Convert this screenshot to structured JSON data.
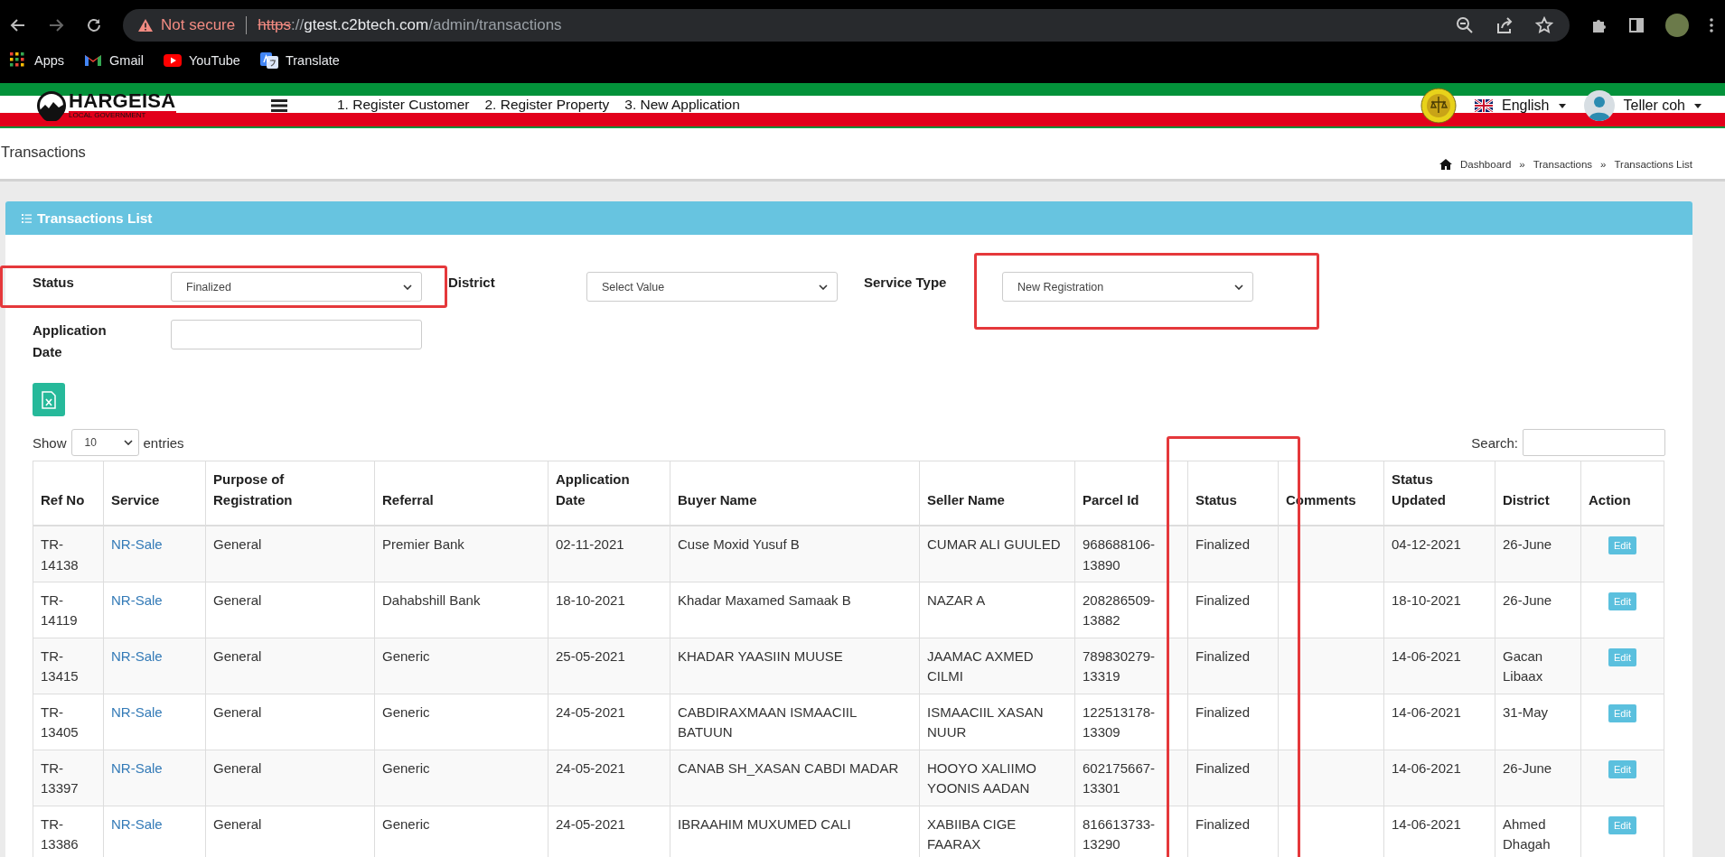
{
  "browser": {
    "warning": "Not secure",
    "url_scheme": "https",
    "url_separator": "://",
    "url_host": "gtest.c2btech.com",
    "url_path": "/admin/transactions",
    "bookmarks": [
      {
        "label": "Apps",
        "kind": "apps"
      },
      {
        "label": "Gmail",
        "kind": "mail"
      },
      {
        "label": "YouTube",
        "kind": "video"
      },
      {
        "label": "Translate",
        "kind": "translate"
      }
    ]
  },
  "header": {
    "logo_title": "HARGEISA",
    "logo_subtitle": "LOCAL GOVERNMENT",
    "nav": [
      "1. Register Customer",
      "2. Register Property",
      "3. New Application"
    ],
    "language": "English",
    "user": "Teller coh"
  },
  "page": {
    "title": "Transactions",
    "breadcrumb": [
      "Dashboard",
      "Transactions",
      "Transactions List"
    ],
    "separator": "»"
  },
  "panel": {
    "title": "Transactions List",
    "filters": [
      {
        "label": "Status",
        "kind": "select",
        "value": "Finalized",
        "highlighted": true
      },
      {
        "label": "District",
        "kind": "select",
        "value": "Select Value",
        "highlighted": false
      },
      {
        "label": "Service Type",
        "kind": "select",
        "value": "New Registration",
        "highlighted": true
      },
      {
        "label": "Application Date",
        "kind": "date",
        "highlighted": false
      }
    ],
    "show_label": "Show",
    "page_size": "10",
    "entries_label": "entries",
    "search_label": "Search:"
  },
  "table": {
    "columns": [
      {
        "label": "Ref No",
        "highlighted": false
      },
      {
        "label": "Service",
        "highlighted": false
      },
      {
        "label": "Purpose of Registration",
        "highlighted": false
      },
      {
        "label": "Referral",
        "highlighted": false
      },
      {
        "label": "Application Date",
        "highlighted": false
      },
      {
        "label": "Buyer Name",
        "highlighted": false
      },
      {
        "label": "Seller Name",
        "highlighted": false
      },
      {
        "label": "Parcel Id",
        "highlighted": false
      },
      {
        "label": "Status",
        "highlighted": true
      },
      {
        "label": "Comments",
        "highlighted": false
      },
      {
        "label": "Status Updated",
        "highlighted": false
      },
      {
        "label": "District",
        "highlighted": false
      },
      {
        "label": "Action",
        "highlighted": false
      }
    ],
    "rows": [
      {
        "ref": "TR-14138",
        "service": "NR-Sale",
        "purpose": "General",
        "referral": "Premier Bank",
        "date": "02-11-2021",
        "buyer": "Cuse Moxid Yusuf B",
        "seller": "CUMAR ALI GUULED",
        "parcel": "968688106-13890",
        "status": "Finalized",
        "updated": "04-12-2021",
        "district": "26-June",
        "action": "Edit"
      },
      {
        "ref": "TR-14119",
        "service": "NR-Sale",
        "purpose": "General",
        "referral": "Dahabshill Bank",
        "date": "18-10-2021",
        "buyer": "Khadar Maxamed Samaak B",
        "seller": "NAZAR A",
        "parcel": "208286509-13882",
        "status": "Finalized",
        "updated": "18-10-2021",
        "district": "26-June",
        "action": "Edit"
      },
      {
        "ref": "TR-13415",
        "service": "NR-Sale",
        "purpose": "General",
        "referral": "Generic",
        "date": "25-05-2021",
        "buyer": "KHADAR YAASIIN MUUSE",
        "seller": "JAAMAC AXMED CILMI",
        "parcel": "789830279-13319",
        "status": "Finalized",
        "updated": "14-06-2021",
        "district": "Gacan Libaax",
        "action": "Edit"
      },
      {
        "ref": "TR-13405",
        "service": "NR-Sale",
        "purpose": "General",
        "referral": "Generic",
        "date": "24-05-2021",
        "buyer": "CABDIRAXMAAN ISMAACIIL BATUUN",
        "seller": "ISMAACIIL XASAN NUUR",
        "parcel": "122513178-13309",
        "status": "Finalized",
        "updated": "14-06-2021",
        "district": "31-May",
        "action": "Edit"
      },
      {
        "ref": "TR-13397",
        "service": "NR-Sale",
        "purpose": "General",
        "referral": "Generic",
        "date": "24-05-2021",
        "buyer": "CANAB SH_XASAN CABDI MADAR",
        "seller": "HOOYO XALIIMO YOONIS AADAN",
        "parcel": "602175667-13301",
        "status": "Finalized",
        "updated": "14-06-2021",
        "district": "26-June",
        "action": "Edit"
      },
      {
        "ref": "TR-13386",
        "service": "NR-Sale",
        "purpose": "General",
        "referral": "Generic",
        "date": "24-05-2021",
        "buyer": "IBRAAHIM MUXUMED CALI",
        "seller": "XABIIBA CIGE FAARAX",
        "parcel": "816613733-13290",
        "status": "Finalized",
        "updated": "14-06-2021",
        "district": "Ahmed Dhagah",
        "action": "Edit"
      }
    ]
  }
}
